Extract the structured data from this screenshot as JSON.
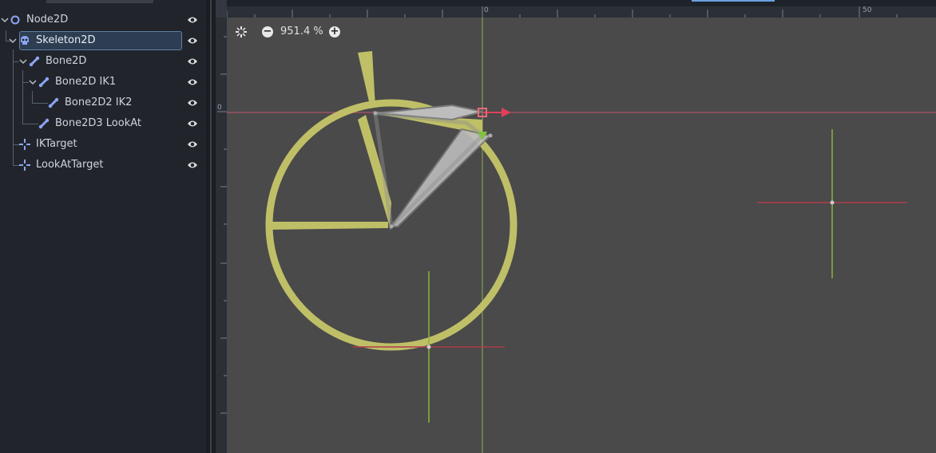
{
  "scene_tree": {
    "nodes": [
      {
        "label": "Node2D",
        "icon": "node2d-circle-icon",
        "visible_icon": "eye-icon"
      },
      {
        "label": "Skeleton2D",
        "icon": "skeleton2d-skull-icon",
        "visible_icon": "eye-icon",
        "selected": true
      },
      {
        "label": "Bone2D",
        "icon": "bone2d-icon",
        "visible_icon": "eye-icon"
      },
      {
        "label": "Bone2D IK1",
        "icon": "bone2d-icon",
        "visible_icon": "eye-icon"
      },
      {
        "label": "Bone2D2 IK2",
        "icon": "bone2d-icon",
        "visible_icon": "eye-icon"
      },
      {
        "label": "Bone2D3 LookAt",
        "icon": "bone2d-icon",
        "visible_icon": "eye-icon"
      },
      {
        "label": "IKTarget",
        "icon": "marker2d-icon",
        "visible_icon": "eye-icon"
      },
      {
        "label": "LookAtTarget",
        "icon": "marker2d-icon",
        "visible_icon": "eye-icon"
      }
    ]
  },
  "viewport": {
    "zoom": {
      "minus_label": "−",
      "value": "951.4 %",
      "plus_label": "+"
    },
    "ruler_top_labels": [
      "0",
      "50"
    ],
    "ruler_left_labels": [
      "0"
    ],
    "colors": {
      "canvas": "#4a4a4a",
      "bone_fill": "#cccc66",
      "x_axis": "#e0405a",
      "y_axis": "#7fc241",
      "accent": "#6aa2e0"
    }
  }
}
